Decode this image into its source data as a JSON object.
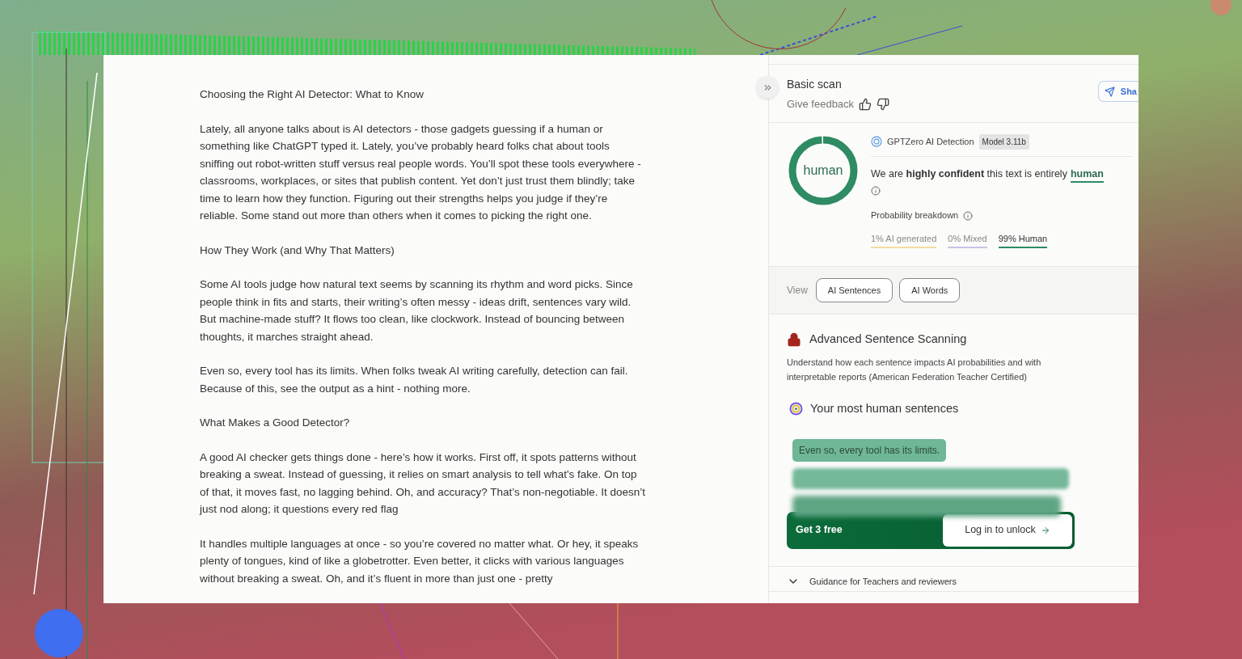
{
  "document": {
    "paragraphs": [
      "Choosing the Right AI Detector: What to Know",
      "Lately, all anyone talks about is AI detectors - those gadgets guessing if a human or something like ChatGPT typed it. Lately, you’ve probably heard folks chat about tools sniffing out robot-written stuff versus real people words. You’ll spot these tools everywhere - classrooms, workplaces, or sites that publish content. Yet don’t just trust them blindly; take time to learn how they function. Figuring out their strengths helps you judge if they’re reliable. Some stand out more than others when it comes to picking the right one.",
      "How They Work (and Why That Matters)",
      "Some AI tools judge how natural text seems by scanning its rhythm and word picks. Since people think in fits and starts, their writing’s often messy - ideas drift, sentences vary wild. But machine-made stuff? It flows too clean, like clockwork. Instead of bouncing between thoughts, it marches straight ahead.",
      "Even so, every tool has its limits. When folks tweak AI writing carefully, detection can fail. Because of this, see the output as a hint - nothing more.",
      "What Makes a Good Detector?",
      "A good AI checker gets things done - here’s how it works. First off, it spots patterns without breaking a sweat. Instead of guessing, it relies on smart analysis to tell what's fake. On top of that, it moves fast, no lagging behind. Oh, and accuracy? That’s non-negotiable. It doesn’t just nod along; it questions every red flag",
      "It handles multiple languages at once - so you’re covered no matter what. Or hey, it speaks plenty of tongues, kind of like a globetrotter. Even better, it clicks with various languages without breaking a sweat. Oh, and it’s fluent in more than just one - pretty"
    ]
  },
  "panel": {
    "title": "Basic scan",
    "feedback": "Give feedback",
    "share": "Sha",
    "result": {
      "ring_label": "human",
      "detector": "GPTZero AI Detection",
      "model": "Model 3.11b",
      "verdict": "We are **highly confident** this text is entirely",
      "verdict_word": "human",
      "breakdown_label": "Probability breakdown",
      "breakdown": [
        {
          "text": "1% AI generated",
          "color": "#f3dca0",
          "strong": false
        },
        {
          "text": "0% Mixed",
          "color": "#c9c3e6",
          "strong": false
        },
        {
          "text": "99% Human",
          "color": "#2e8b63",
          "strong": true
        }
      ]
    },
    "view": {
      "label": "View",
      "buttons": [
        "AI Sentences",
        "AI Words"
      ]
    },
    "advanced": {
      "title": "Advanced Sentence Scanning",
      "description": "Understand how each sentence impacts AI probabilities and with interpretable reports (American Federation Teacher Certified)",
      "human_title": "Your most human sentences",
      "sentence": "Even so, every tool has its limits.",
      "get_free": "Get 3 free",
      "unlock": "Log in to unlock"
    },
    "guidance": {
      "label": "Guidance for Teachers and reviewers",
      "expanded": false
    }
  }
}
